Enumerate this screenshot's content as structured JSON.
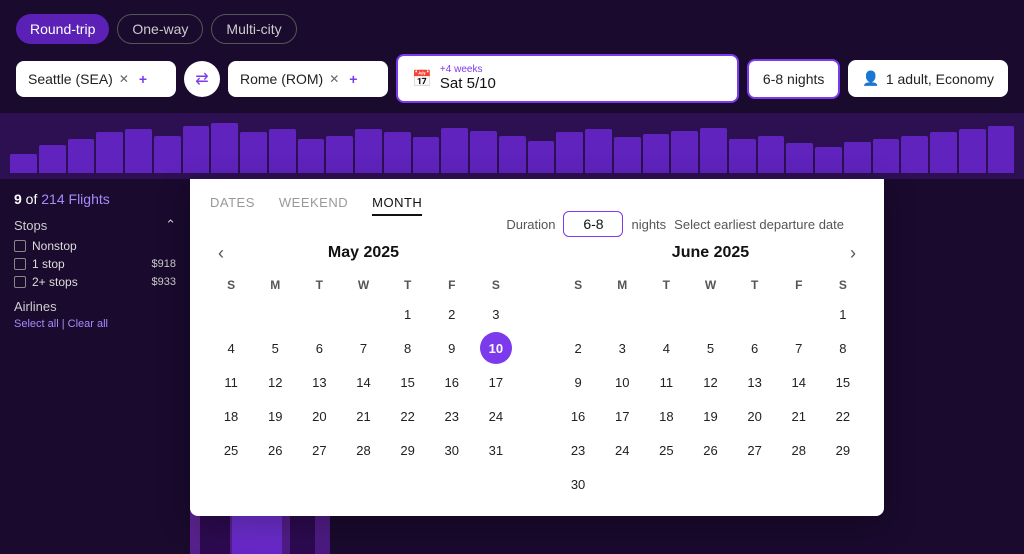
{
  "tripTypes": [
    {
      "id": "round-trip",
      "label": "Round-trip",
      "active": true
    },
    {
      "id": "one-way",
      "label": "One-way",
      "active": false
    },
    {
      "id": "multi-city",
      "label": "Multi-city",
      "active": false
    }
  ],
  "origin": "Seattle (SEA)",
  "destination": "Rome (ROM)",
  "dateLabel": "+4 weeks",
  "dateValue": "Sat 5/10",
  "nights": "6-8 nights",
  "travelers": "1 adult, Economy",
  "flightsCount": "9 of 214 Flights",
  "filters": {
    "stops": {
      "label": "Stops",
      "items": [
        {
          "label": "Nonstop",
          "price": ""
        },
        {
          "label": "1 stop",
          "price": "$918"
        },
        {
          "label": "2+ stops",
          "price": "$933"
        }
      ]
    },
    "airlines": {
      "label": "Airlines",
      "selectAll": "Select all",
      "clearAll": "Clear all"
    }
  },
  "calendar": {
    "tabs": [
      {
        "id": "dates",
        "label": "DATES",
        "active": false
      },
      {
        "id": "weekend",
        "label": "WEEKEND",
        "active": false
      },
      {
        "id": "month",
        "label": "MONTH",
        "active": true
      }
    ],
    "durationLabel": "Duration",
    "durationValue": "6-8",
    "nightsLabel": "nights",
    "selectPrompt": "Select earliest departure date",
    "months": [
      {
        "name": "May 2025",
        "year": 2025,
        "month": 4,
        "days": [
          {
            "d": "",
            "empty": true
          },
          {
            "d": "",
            "empty": true
          },
          {
            "d": "",
            "empty": true
          },
          {
            "d": "",
            "empty": true
          },
          {
            "d": "1"
          },
          {
            "d": "2"
          },
          {
            "d": "3"
          },
          {
            "d": "4"
          },
          {
            "d": "5"
          },
          {
            "d": "6"
          },
          {
            "d": "7"
          },
          {
            "d": "8"
          },
          {
            "d": "9"
          },
          {
            "d": "10",
            "selected": true
          },
          {
            "d": "11"
          },
          {
            "d": "12"
          },
          {
            "d": "13"
          },
          {
            "d": "14"
          },
          {
            "d": "15"
          },
          {
            "d": "16"
          },
          {
            "d": "17"
          },
          {
            "d": "18"
          },
          {
            "d": "19"
          },
          {
            "d": "20"
          },
          {
            "d": "21"
          },
          {
            "d": "22"
          },
          {
            "d": "23"
          },
          {
            "d": "24"
          },
          {
            "d": "25"
          },
          {
            "d": "26"
          },
          {
            "d": "27"
          },
          {
            "d": "28"
          },
          {
            "d": "29"
          },
          {
            "d": "30"
          },
          {
            "d": "31"
          }
        ]
      },
      {
        "name": "June 2025",
        "year": 2025,
        "month": 5,
        "days": [
          {
            "d": "",
            "empty": true
          },
          {
            "d": "",
            "empty": true
          },
          {
            "d": "",
            "empty": true
          },
          {
            "d": "",
            "empty": true
          },
          {
            "d": "",
            "empty": true
          },
          {
            "d": "",
            "empty": true
          },
          {
            "d": "1"
          },
          {
            "d": "2"
          },
          {
            "d": "3"
          },
          {
            "d": "4"
          },
          {
            "d": "5"
          },
          {
            "d": "6"
          },
          {
            "d": "7"
          },
          {
            "d": "8"
          },
          {
            "d": "9"
          },
          {
            "d": "10"
          },
          {
            "d": "11"
          },
          {
            "d": "12"
          },
          {
            "d": "13"
          },
          {
            "d": "14"
          },
          {
            "d": "15"
          },
          {
            "d": "16"
          },
          {
            "d": "17"
          },
          {
            "d": "18"
          },
          {
            "d": "19"
          },
          {
            "d": "20"
          },
          {
            "d": "21"
          },
          {
            "d": "22"
          },
          {
            "d": "23"
          },
          {
            "d": "24"
          },
          {
            "d": "25"
          },
          {
            "d": "26"
          },
          {
            "d": "27"
          },
          {
            "d": "28"
          },
          {
            "d": "29"
          },
          {
            "d": "30"
          }
        ]
      }
    ],
    "dayHeaders": [
      "S",
      "M",
      "T",
      "W",
      "T",
      "F",
      "S"
    ]
  },
  "histogram": {
    "bars": [
      30,
      45,
      55,
      65,
      70,
      60,
      75,
      80,
      65,
      70,
      55,
      60,
      70,
      65,
      58,
      72,
      68,
      60,
      52,
      65,
      70,
      58,
      62,
      68,
      72,
      55,
      60,
      48,
      42,
      50,
      55,
      60,
      65,
      70,
      75
    ]
  }
}
